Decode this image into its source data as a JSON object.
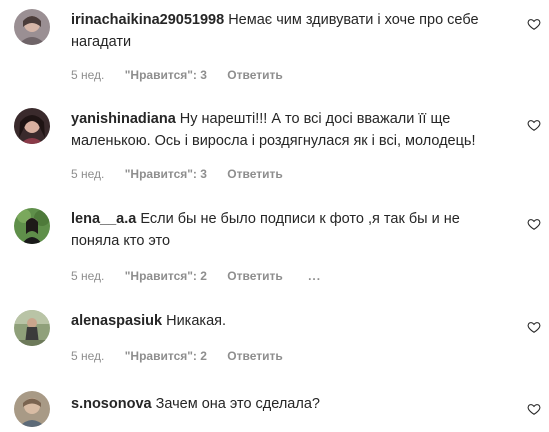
{
  "comments": [
    {
      "username": "irinachaikina29051998",
      "text": "Немає чим здивувати і хоче про себе нагадати",
      "time": "5 нед.",
      "likes": "\"Нравится\": 3",
      "reply": "Ответить",
      "avatar_icon": "user-avatar"
    },
    {
      "username": "yanishinadiana",
      "text": "Ну нарешті!!! А то всі досі вважали її ще маленькою. Ось і виросла і роздягнулася як і всі, молодець!",
      "time": "5 нед.",
      "likes": "\"Нравится\": 3",
      "reply": "Ответить",
      "avatar_icon": "user-avatar"
    },
    {
      "username": "lena__a.a",
      "text": "Если бы не было подписи к фото ,я так бы и не поняла кто это",
      "time": "5 нед.",
      "likes": "\"Нравится\": 2",
      "reply": "Ответить",
      "more": "...",
      "avatar_icon": "user-avatar"
    },
    {
      "username": "alenaspasiuk",
      "text": "Никакая.",
      "time": "5 нед.",
      "likes": "\"Нравится\": 2",
      "reply": "Ответить",
      "avatar_icon": "user-avatar"
    },
    {
      "username": "s.nosonova",
      "text": "Зачем она это сделала?",
      "avatar_icon": "user-avatar"
    }
  ],
  "icons": {
    "like": "heart-icon"
  },
  "colors": {
    "text": "#262626",
    "secondary": "#8e8e8e"
  }
}
